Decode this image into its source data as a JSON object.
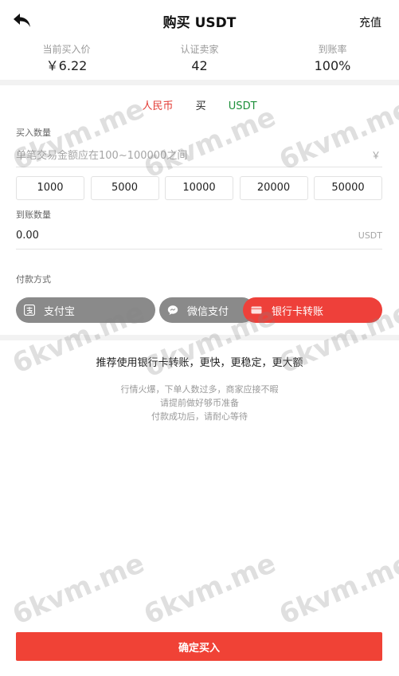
{
  "header": {
    "title": "购买 USDT",
    "recharge_label": "充值"
  },
  "stats": [
    {
      "label": "当前买入价",
      "value": "￥6.22"
    },
    {
      "label": "认证卖家",
      "value": "42"
    },
    {
      "label": "到账率",
      "value": "100%"
    }
  ],
  "pair": {
    "from": "人民币",
    "action": "买",
    "to": "USDT"
  },
  "buy_amount": {
    "label": "买入数量",
    "placeholder": "单笔交易金额应在100~100000之间",
    "unit": "￥"
  },
  "presets": [
    "1000",
    "5000",
    "10000",
    "20000",
    "50000"
  ],
  "receive": {
    "label": "到账数量",
    "value": "0.00",
    "unit": "USDT"
  },
  "payment": {
    "label": "付款方式",
    "methods": [
      {
        "label": "支付宝",
        "icon": "alipay-icon"
      },
      {
        "label": "微信支付",
        "icon": "wechat-icon"
      },
      {
        "label": "银行卡转账",
        "icon": "bank-card-icon"
      }
    ]
  },
  "recommend_text": "推荐使用银行卡转账，更快，更稳定，更大额",
  "notes": [
    "行情火爆，下单人数过多，商家应接不暇",
    "请提前做好够币准备",
    "付款成功后，请耐心等待"
  ],
  "confirm_label": "确定买入",
  "watermark": "6kvm.me",
  "colors": {
    "accent_red": "#ee403a",
    "usdt_green": "#1d8f3a",
    "inactive_gray": "#8a8a8a"
  }
}
